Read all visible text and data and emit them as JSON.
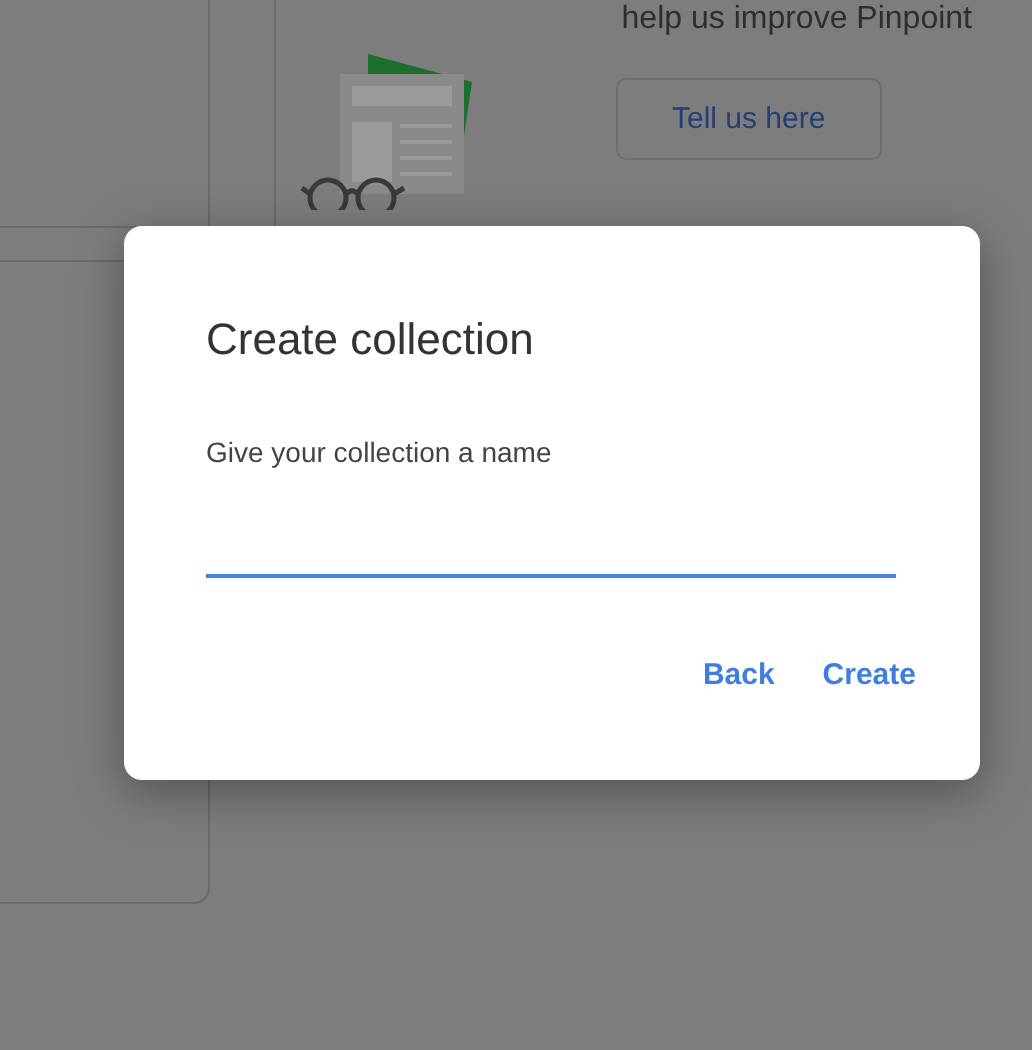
{
  "background": {
    "feedback_card": {
      "text": "help us improve Pinpoint",
      "button": "Tell us here"
    }
  },
  "dialog": {
    "title": "Create collection",
    "field": {
      "label": "Give your collection a name",
      "focused": true
    },
    "buttons": [
      "Back",
      "Create"
    ]
  }
}
